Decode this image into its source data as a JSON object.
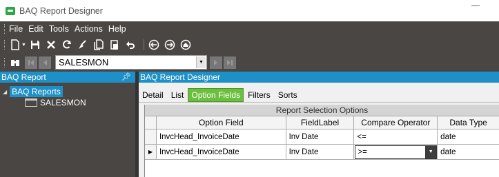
{
  "window": {
    "title": "BAQ Report Designer"
  },
  "menu": {
    "items": [
      "File",
      "Edit",
      "Tools",
      "Actions",
      "Help"
    ]
  },
  "toolbar": {
    "icons": [
      "new-icon",
      "save-icon",
      "delete-icon",
      "refresh-icon",
      "clear-icon",
      "copy-icon",
      "paste-icon",
      "undo-icon",
      "back-icon",
      "forward-icon",
      "home-icon"
    ]
  },
  "navigation": {
    "search_icon": "binoculars-icon",
    "current_record": "SALESMON"
  },
  "left_panel": {
    "title": "BAQ Report",
    "tree": {
      "root": "BAQ Reports",
      "children": [
        "SALESMON"
      ]
    }
  },
  "right_panel": {
    "title": "BAQ Report Designer",
    "tabs": [
      "Detail",
      "List",
      "Option Fields",
      "Filters",
      "Sorts"
    ],
    "active_tab": "Option Fields",
    "grid": {
      "band_title": "Report Selection Options",
      "columns": [
        "Option Field",
        "FieldLabel",
        "Compare Operator",
        "Data Type"
      ],
      "rows": [
        {
          "option_field": "InvcHead_InvoiceDate",
          "field_label": "Inv Date",
          "compare_operator": "<=",
          "data_type": "date"
        },
        {
          "option_field": "InvcHead_InvoiceDate",
          "field_label": "Inv Date",
          "compare_operator": ">=",
          "data_type": "date"
        }
      ]
    }
  },
  "colors": {
    "accent": "#1e90c8",
    "toolbar_bg": "#4a4644",
    "active_tab": "#6cbe3e"
  }
}
